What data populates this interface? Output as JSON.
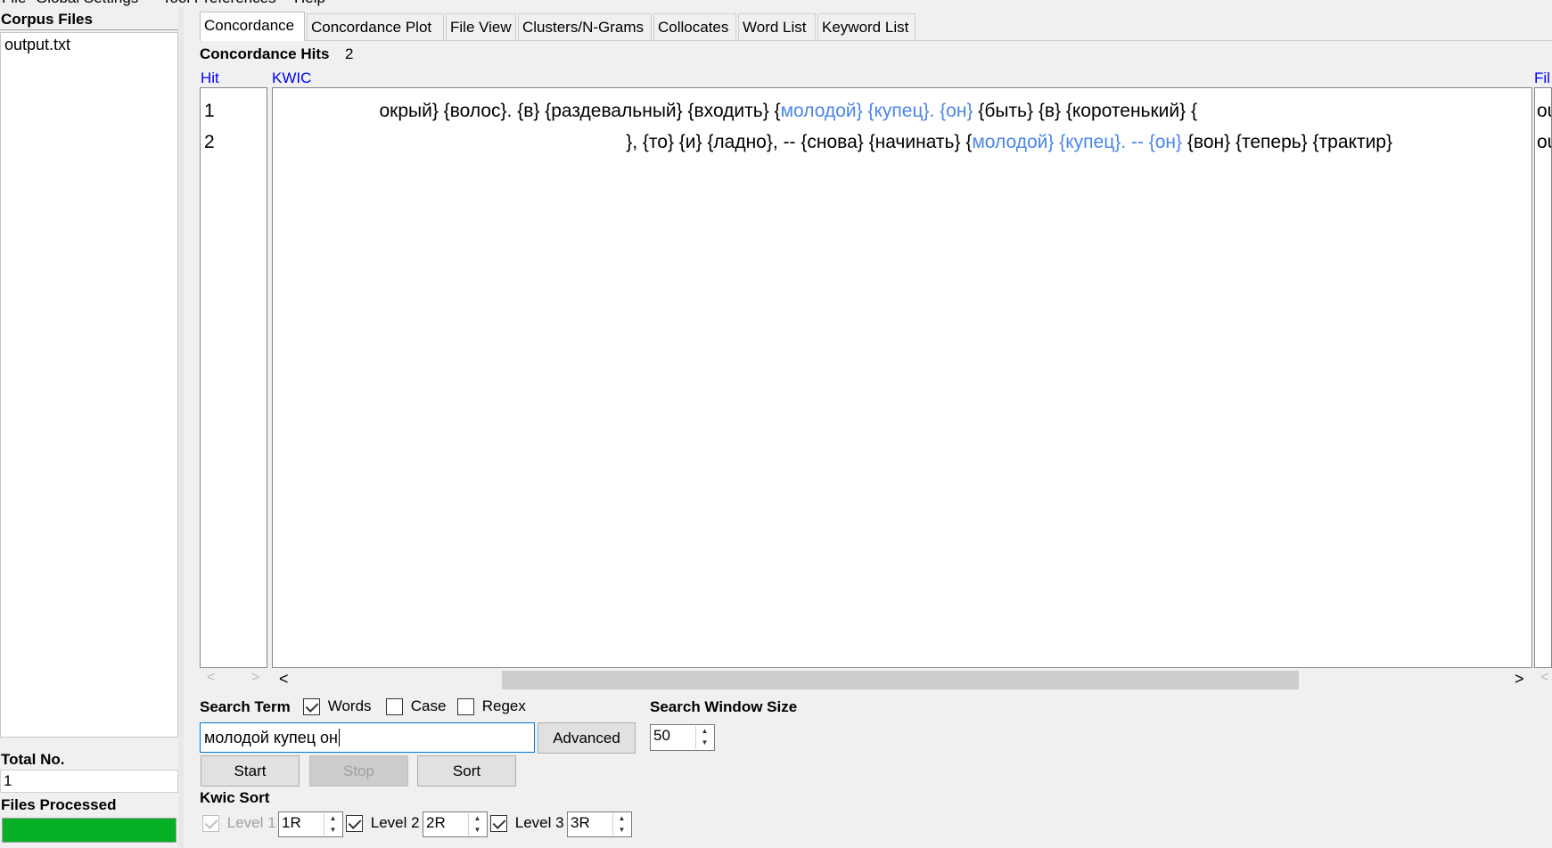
{
  "menu": [
    "File",
    "Global Settings",
    "Tool Preferences",
    "Help"
  ],
  "left": {
    "corpus_label": "Corpus Files",
    "files": [
      "output.txt"
    ],
    "total_label": "Total No.",
    "total_value": "1",
    "processed_label": "Files Processed",
    "progress": 1.0
  },
  "tabs": [
    "Concordance",
    "Concordance Plot",
    "File View",
    "Clusters/N-Grams",
    "Collocates",
    "Word List",
    "Keyword List"
  ],
  "hits": {
    "label": "Concordance Hits",
    "value": "2"
  },
  "columns": {
    "hit": "Hit",
    "kwic": "KWIC",
    "file": "Fil"
  },
  "rows": [
    {
      "hit": "1",
      "left": "окрый} {волос}.    {в} {раздевальный} {входить} {",
      "key": "молодой} {купец}. {он}",
      "right": " {быть} {в} {коротенький} {",
      "file": "ou"
    },
    {
      "hit": "2",
      "left": "}, {то} {и} {ладно}, -- {снова} {начинать} {",
      "key": "молодой} {купец}. -- {он}",
      "right": " {вон} {теперь} {трактир}",
      "file": "ou"
    }
  ],
  "search": {
    "label": "Search Term",
    "words_label": "Words",
    "case_label": "Case",
    "regex_label": "Regex",
    "query": "молодой купец он",
    "advanced_label": "Advanced",
    "window_label": "Search Window Size",
    "window_value": "50",
    "start_label": "Start",
    "stop_label": "Stop",
    "sort_label": "Sort"
  },
  "kwic_sort": {
    "label": "Kwic Sort",
    "levels": [
      {
        "label": "Level 1",
        "value": "1R"
      },
      {
        "label": "Level 2",
        "value": "2R"
      },
      {
        "label": "Level 3",
        "value": "3R"
      }
    ]
  }
}
